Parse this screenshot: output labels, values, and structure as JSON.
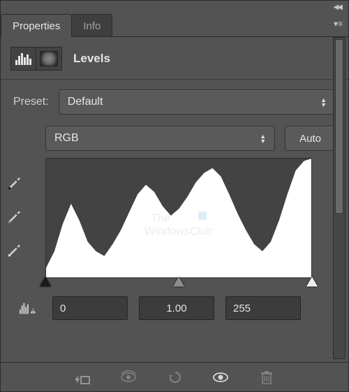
{
  "tabs": {
    "properties": "Properties",
    "info": "Info"
  },
  "adjustment": {
    "title": "Levels"
  },
  "preset": {
    "label": "Preset:",
    "value": "Default"
  },
  "channel": {
    "value": "RGB"
  },
  "auto": {
    "label": "Auto"
  },
  "input_levels": {
    "black": "0",
    "gamma": "1.00",
    "white": "255"
  },
  "watermark": {
    "line1": "The",
    "line2": "WindowsClub"
  },
  "icons": {
    "collapse": "◀◀",
    "menu": "▾≡"
  },
  "chart_data": {
    "type": "area",
    "title": "Histogram",
    "xlabel": "",
    "ylabel": "",
    "xlim": [
      0,
      255
    ],
    "ylim": [
      0,
      100
    ],
    "x": [
      0,
      8,
      16,
      24,
      32,
      40,
      48,
      56,
      64,
      72,
      80,
      88,
      96,
      104,
      112,
      120,
      128,
      136,
      144,
      152,
      160,
      168,
      176,
      184,
      192,
      200,
      208,
      216,
      224,
      232,
      240,
      248,
      255
    ],
    "values": [
      8,
      22,
      45,
      62,
      48,
      30,
      22,
      18,
      28,
      40,
      55,
      70,
      78,
      72,
      60,
      52,
      58,
      68,
      80,
      88,
      92,
      85,
      70,
      54,
      40,
      28,
      22,
      30,
      48,
      70,
      90,
      98,
      100
    ]
  }
}
